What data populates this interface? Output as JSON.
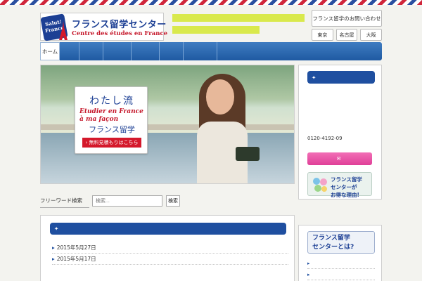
{
  "header": {
    "logo_badge_line1": "Salut!",
    "logo_badge_line2": "France",
    "logo_name": "フランス留学センター",
    "logo_sub": "Centre des études en France",
    "tagline_line1": "",
    "tagline_line2": "",
    "contact_label": "フランス留学のお問い合わせ",
    "cities": [
      "東京",
      "名古屋",
      "大阪"
    ]
  },
  "nav": {
    "items": [
      {
        "label": "ホーム",
        "active": true,
        "width": 28
      },
      {
        "label": "",
        "active": false,
        "width": 28
      },
      {
        "label": "",
        "active": false,
        "width": 34
      },
      {
        "label": "",
        "active": false,
        "width": 40
      },
      {
        "label": "",
        "active": false,
        "width": 40
      },
      {
        "label": "",
        "active": false,
        "width": 34
      },
      {
        "label": "",
        "active": false,
        "width": 48
      }
    ]
  },
  "hero": {
    "title": "わたし流",
    "script_line1": "Etudier en France",
    "script_line2": "à ma façon",
    "subtitle": "フランス留学",
    "cta": "› 無料見積もりはこちら"
  },
  "search": {
    "label": "フリーワード検索",
    "placeholder": "検索...",
    "button": "検索"
  },
  "news": {
    "heading": "",
    "items": [
      {
        "date": "2015年5月27日",
        "text": ""
      },
      {
        "date": "2015年5月17日",
        "text": ""
      }
    ],
    "more": ""
  },
  "sidebar": {
    "heading": "",
    "text_pre": "",
    "text_hl": "",
    "text_post": "",
    "hours": "",
    "tel": "0120-4192-09",
    "counsel_button": "",
    "banner_line1": "フランス留学",
    "banner_line2": "センターが",
    "banner_line3": "お得な理由!"
  },
  "about": {
    "title_line1": "フランス留学",
    "title_line2": "センターとは?",
    "links": [
      "",
      "",
      ""
    ]
  },
  "colors": {
    "brand_blue": "#1f4fa0",
    "accent_red": "#d4182b",
    "pink": "#e03f98",
    "highlight": "#d9e94c"
  }
}
